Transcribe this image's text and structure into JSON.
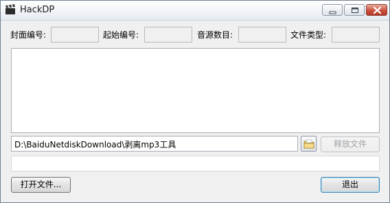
{
  "window": {
    "title": "HackDP"
  },
  "form": {
    "cover_label": "封面编号:",
    "cover_value": "",
    "start_label": "起始编号:",
    "start_value": "",
    "audio_label": "音源数目:",
    "audio_value": "",
    "filetype_label": "文件类型:",
    "filetype_value": ""
  },
  "path": {
    "value": "D:\\BaiduNetdiskDownload\\剥离mp3工具"
  },
  "buttons": {
    "release": "释放文件",
    "open": "打开文件...",
    "exit": "退出"
  },
  "icons": {
    "app": "clapperboard-icon",
    "browse": "folder-icon",
    "minimize": "minimize-icon",
    "maximize": "maximize-icon",
    "close": "close-icon"
  }
}
